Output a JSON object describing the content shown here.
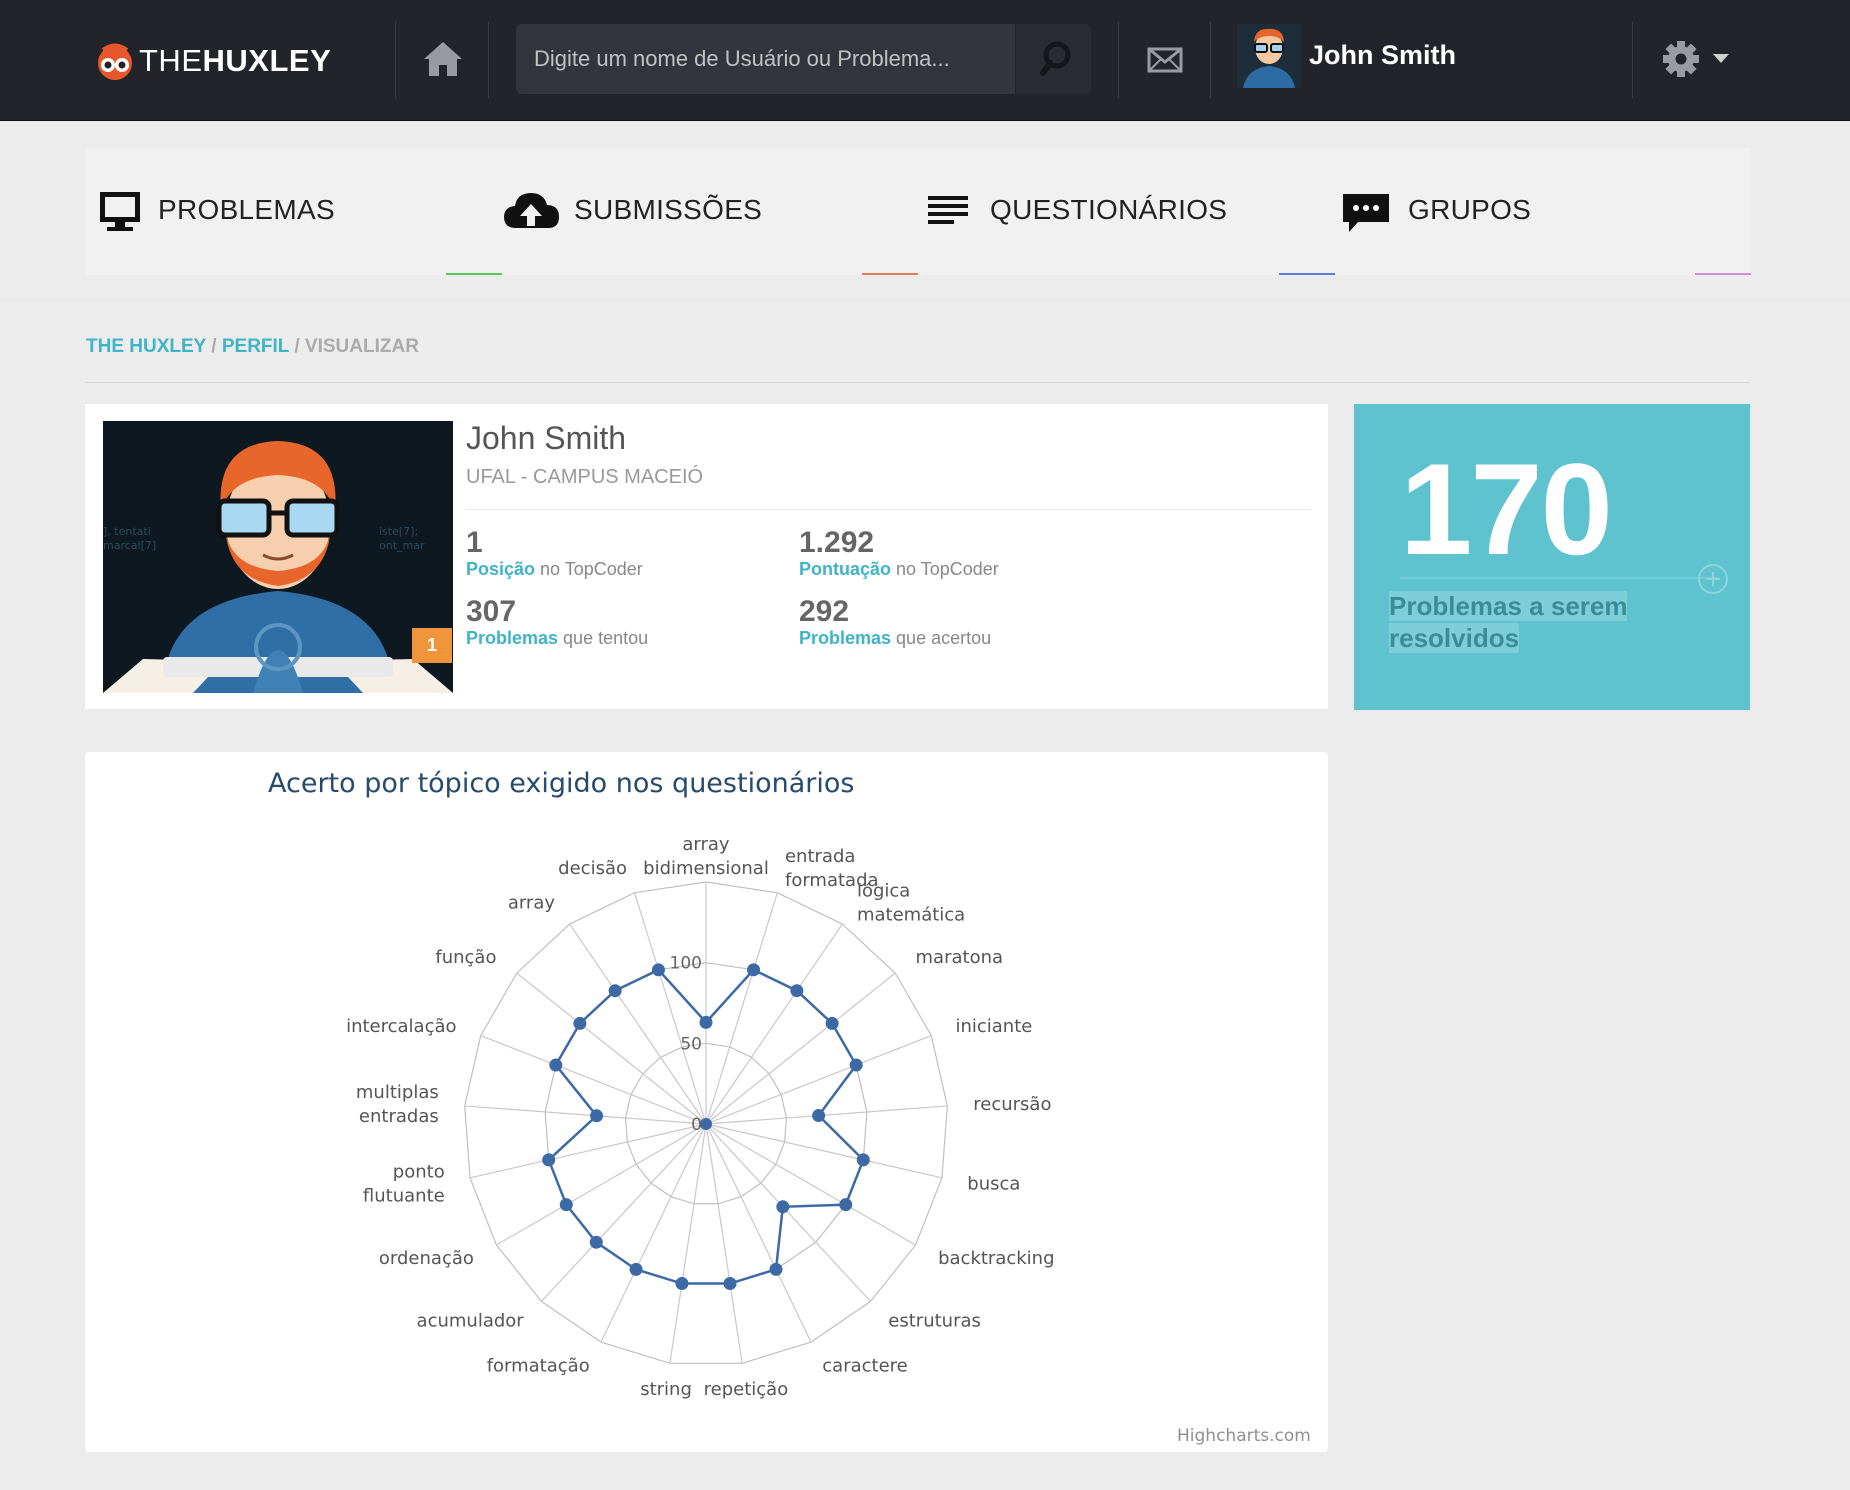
{
  "header": {
    "logo_thin": "THE",
    "logo_bold": "HUXLEY",
    "search_placeholder": "Digite um nome de Usuário ou Problema...",
    "user_name": "John Smith"
  },
  "nav": [
    {
      "label": "PROBLEMAS",
      "accent": "#5cc65c"
    },
    {
      "label": "SUBMISSÕES",
      "accent": "#e57c5c"
    },
    {
      "label": "QUESTIONÁRIOS",
      "accent": "#5c7cd8"
    },
    {
      "label": "GRUPOS",
      "accent": "#d58ad8"
    }
  ],
  "breadcrumb": {
    "root": "THE HUXLEY",
    "section": "PERFIL",
    "current": "VISUALIZAR",
    "sep": " / "
  },
  "profile": {
    "name": "John Smith",
    "institution": "UFAL - CAMPUS MACEIÓ",
    "badge": "1",
    "stats": [
      {
        "value": "1",
        "label": "Posição",
        "suffix": " no TopCoder"
      },
      {
        "value": "1.292",
        "label": "Pontuação",
        "suffix": " no TopCoder"
      },
      {
        "value": "307",
        "label": "Problemas",
        "suffix": " que tentou"
      },
      {
        "value": "292",
        "label": "Problemas",
        "suffix": " que acertou"
      }
    ]
  },
  "summary": {
    "number": "170",
    "caption_1": "Problemas a serem",
    "caption_2": "resolvidos"
  },
  "chart_data": {
    "type": "radar",
    "title": "Acerto por tópico exigido nos questionários",
    "credits": "Highcharts.com",
    "series_color": "#3d6aa5",
    "radial_ticks": [
      0,
      50,
      100
    ],
    "max": 150,
    "categories": [
      [
        "array",
        "bidimensional"
      ],
      [
        "entrada",
        "formatada"
      ],
      [
        "lógica",
        "matemática"
      ],
      [
        "maratona"
      ],
      [
        "iniciante"
      ],
      [
        "recursão"
      ],
      [
        "busca"
      ],
      [
        "backtracking"
      ],
      [
        "estruturas"
      ],
      [
        "caractere"
      ],
      [
        "repetição"
      ],
      [
        "string"
      ],
      [
        "formatação"
      ],
      [
        "acumulador"
      ],
      [
        "ordenação"
      ],
      [
        "ponto",
        "flutuante"
      ],
      [
        "multiplas",
        "entradas"
      ],
      [
        "intercalação"
      ],
      [
        "função"
      ],
      [
        "array"
      ],
      [
        "decisão"
      ]
    ],
    "values": [
      63,
      100,
      100,
      100,
      100,
      70,
      100,
      100,
      70,
      100,
      100,
      100,
      100,
      100,
      100,
      100,
      68,
      100,
      100,
      100,
      100
    ]
  }
}
